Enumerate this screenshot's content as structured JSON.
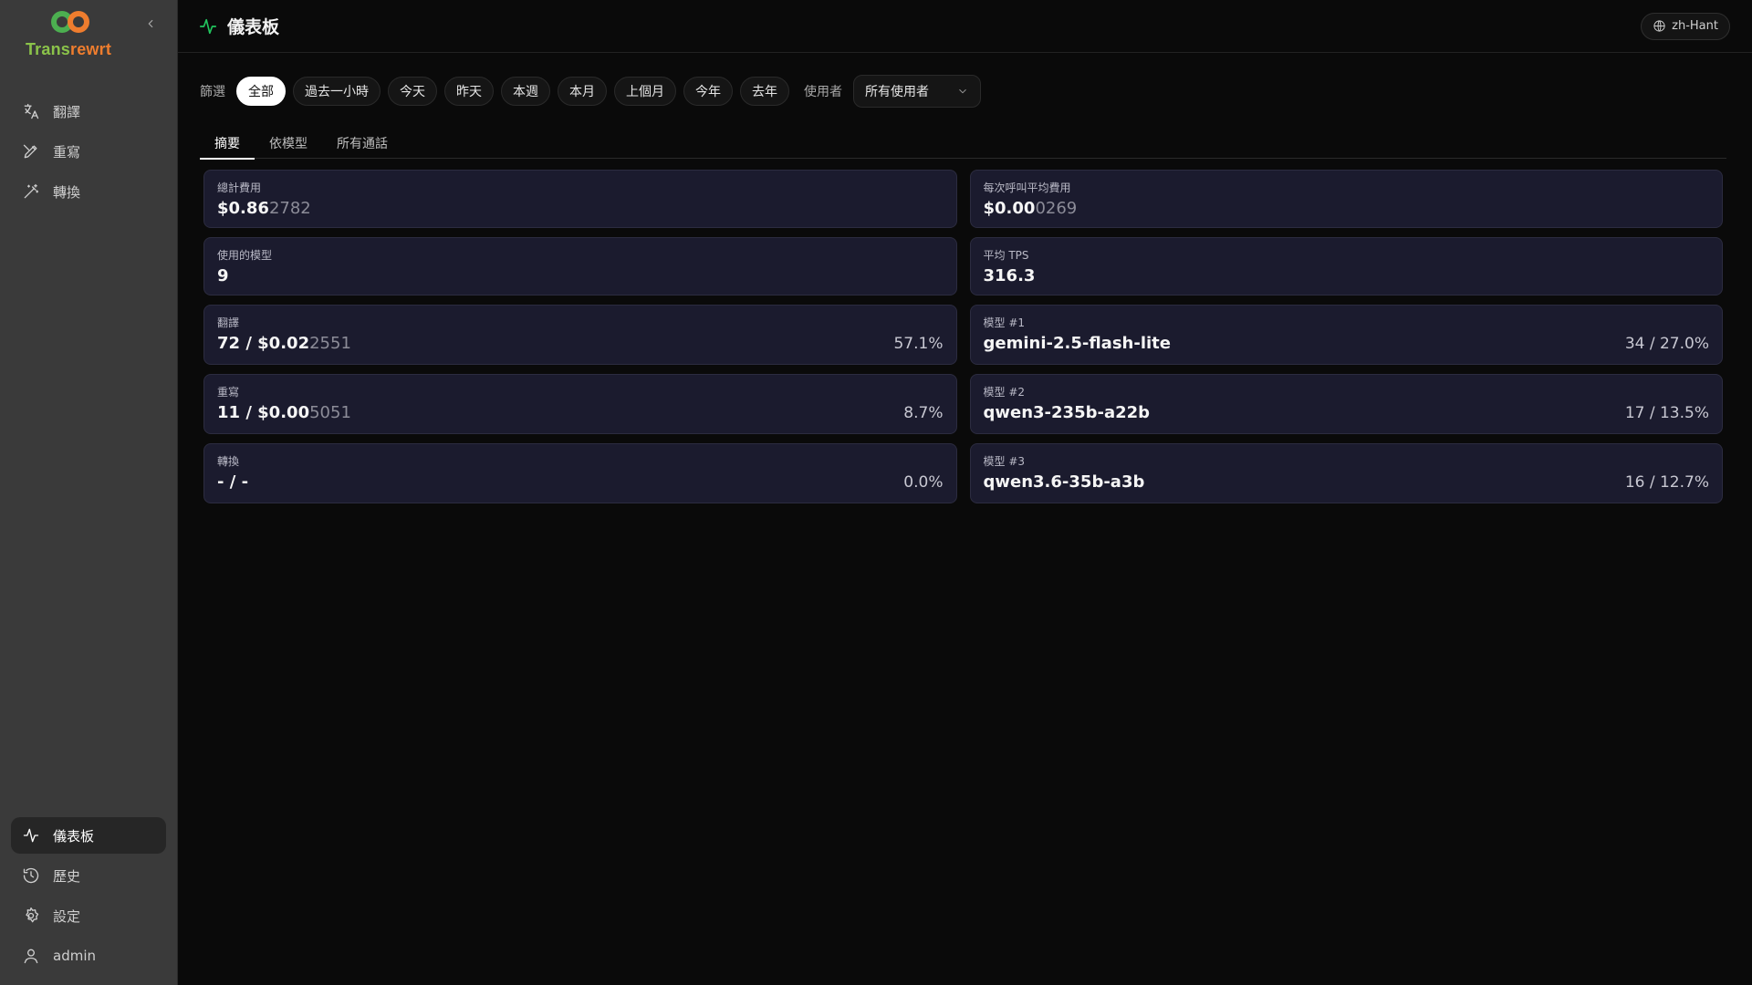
{
  "brand": {
    "name_part1": "Trans",
    "name_part2": "rewrt"
  },
  "sidebar": {
    "items": [
      {
        "label": "翻譯",
        "icon": "translate-icon"
      },
      {
        "label": "重寫",
        "icon": "pen-icon"
      },
      {
        "label": "轉換",
        "icon": "wand-icon"
      }
    ],
    "bottom_items": [
      {
        "label": "儀表板",
        "icon": "activity-icon",
        "active": true
      },
      {
        "label": "歷史",
        "icon": "history-icon"
      },
      {
        "label": "設定",
        "icon": "gear-icon"
      },
      {
        "label": "admin",
        "icon": "user-icon"
      }
    ]
  },
  "header": {
    "title": "儀表板",
    "language": "zh-Hant"
  },
  "filters": {
    "label": "篩選",
    "chips": [
      "全部",
      "過去一小時",
      "今天",
      "昨天",
      "本週",
      "本月",
      "上個月",
      "今年",
      "去年"
    ],
    "active_chip": "全部",
    "user_label": "使用者",
    "user_select": "所有使用者"
  },
  "tabs": [
    "摘要",
    "依模型",
    "所有通話"
  ],
  "active_tab": "摘要",
  "cards": {
    "total_cost": {
      "label": "總計費用",
      "bright": "$0.86",
      "dim": "2782"
    },
    "avg_cost": {
      "label": "每次呼叫平均費用",
      "bright": "$0.00",
      "dim": "0269"
    },
    "models_used": {
      "label": "使用的模型",
      "value": "9"
    },
    "avg_tps": {
      "label": "平均 TPS",
      "value": "316.3"
    },
    "translate": {
      "label": "翻譯",
      "bright": "72 / $0.02",
      "dim": "2551",
      "pct": "57.1%"
    },
    "rewrite": {
      "label": "重寫",
      "bright": "11 / $0.00",
      "dim": "5051",
      "pct": "8.7%"
    },
    "convert": {
      "label": "轉換",
      "value": "- / -",
      "pct": "0.0%"
    },
    "model1": {
      "label": "模型 #1",
      "value": "gemini-2.5-flash-lite",
      "stat": "34 / 27.0%"
    },
    "model2": {
      "label": "模型 #2",
      "value": "qwen3-235b-a22b",
      "stat": "17 / 13.5%"
    },
    "model3": {
      "label": "模型 #3",
      "value": "qwen3.6-35b-a3b",
      "stat": "16 / 12.7%"
    }
  },
  "colors": {
    "accent": "#22c55e",
    "card_bg": "#1b1b2e",
    "sidebar_bg": "#3a3a3a"
  }
}
